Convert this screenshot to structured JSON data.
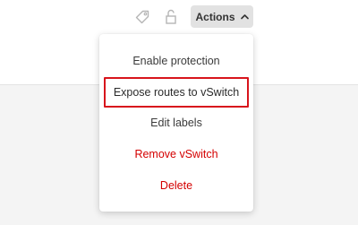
{
  "toolbar": {
    "label_icon": "tag-icon",
    "lock_icon": "lock-icon",
    "actions_label": "Actions",
    "actions_icon": "chevron-up-icon"
  },
  "menu": {
    "items": [
      {
        "label": "Enable protection",
        "style": "normal"
      },
      {
        "label": "Expose routes to vSwitch",
        "style": "highlighted"
      },
      {
        "label": "Edit labels",
        "style": "normal"
      },
      {
        "label": "Remove vSwitch",
        "style": "danger"
      },
      {
        "label": "Delete",
        "style": "danger"
      }
    ]
  },
  "colors": {
    "danger": "#d40000",
    "highlight_border": "#d8141c",
    "button_bg": "#e2e2e2"
  }
}
